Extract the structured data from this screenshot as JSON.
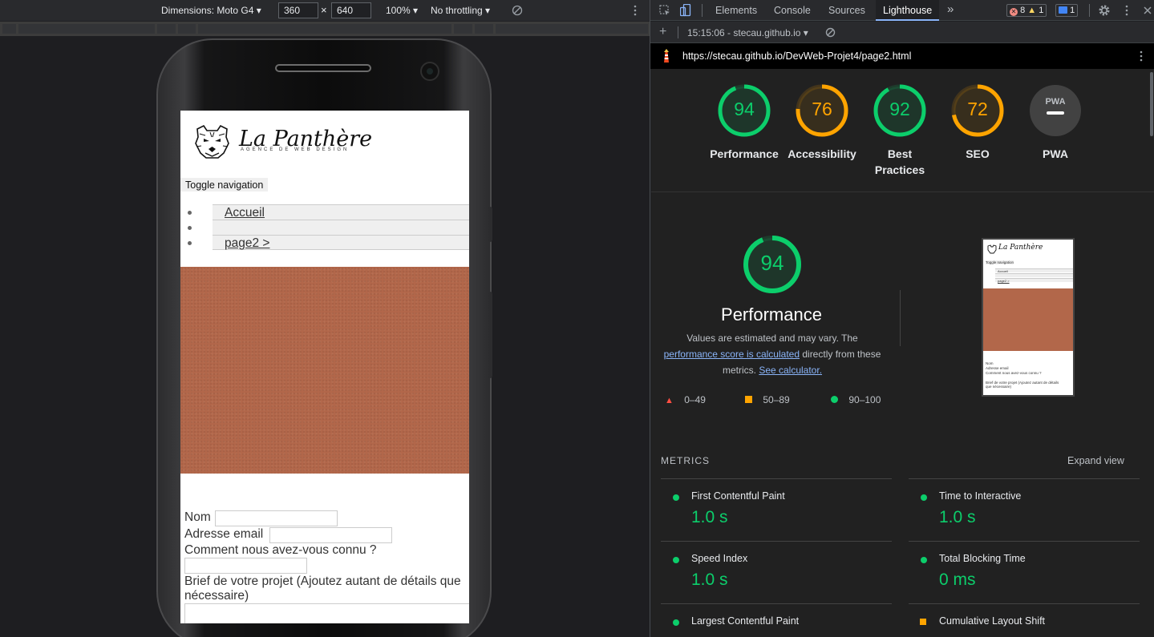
{
  "device_toolbar": {
    "dimensions_label": "Dimensions: Moto G4",
    "width": "360",
    "times": "×",
    "height": "640",
    "zoom": "100%",
    "throttling": "No throttling"
  },
  "devtools": {
    "tabs": [
      "Elements",
      "Console",
      "Sources",
      "Lighthouse"
    ],
    "active_tab": "Lighthouse",
    "more": "»",
    "errors": "8",
    "warnings": "1",
    "messages": "1",
    "report_time": "15:15:06 - stecau.github.io",
    "url": "https://stecau.github.io/DevWeb-Projet4/page2.html"
  },
  "scores": [
    {
      "label": "Performance",
      "value": "94",
      "score": 94,
      "color": "#0cce6b"
    },
    {
      "label": "Accessibility",
      "value": "76",
      "score": 76,
      "color": "#ffa400"
    },
    {
      "label": "Best Practices",
      "value": "92",
      "score": 92,
      "color": "#0cce6b"
    },
    {
      "label": "SEO",
      "value": "72",
      "score": 72,
      "color": "#ffa400"
    },
    {
      "label": "PWA",
      "value": "PWA",
      "score": null,
      "color": "#9aa0a6"
    }
  ],
  "performance": {
    "score": "94",
    "title": "Performance",
    "desc_before": "Values are estimated and may vary. The ",
    "desc_link": "performance score is calculated",
    "desc_middle": " directly from these metrics. ",
    "calc_link": "See calculator.",
    "legend": [
      "0–49",
      "50–89",
      "90–100"
    ]
  },
  "metrics": {
    "heading": "METRICS",
    "expand": "Expand view",
    "fcp_label": "First Contentful Paint",
    "fcp_value": "1.0 s",
    "tti_label": "Time to Interactive",
    "tti_value": "1.0 s",
    "si_label": "Speed Index",
    "si_value": "1.0 s",
    "tbt_label": "Total Blocking Time",
    "tbt_value": "0 ms",
    "lcp_label": "Largest Contentful Paint",
    "cls_label": "Cumulative Layout Shift"
  },
  "site": {
    "brand": "La Panthère",
    "tagline": "AGENCE DE WEB DESIGN",
    "toggle": "Toggle navigation",
    "nav": [
      "Accueil",
      "",
      "page2 >"
    ],
    "form": {
      "nom": "Nom",
      "email": "Adresse email",
      "connu": "Comment nous avez-vous connu ?",
      "brief": "Brief de votre projet (Ajoutez autant de détails que nécessaire)"
    }
  },
  "colors": {
    "pass": "#0cce6b",
    "average": "#ffa400",
    "fail": "#ff4e42",
    "link": "#8ab4f8"
  }
}
